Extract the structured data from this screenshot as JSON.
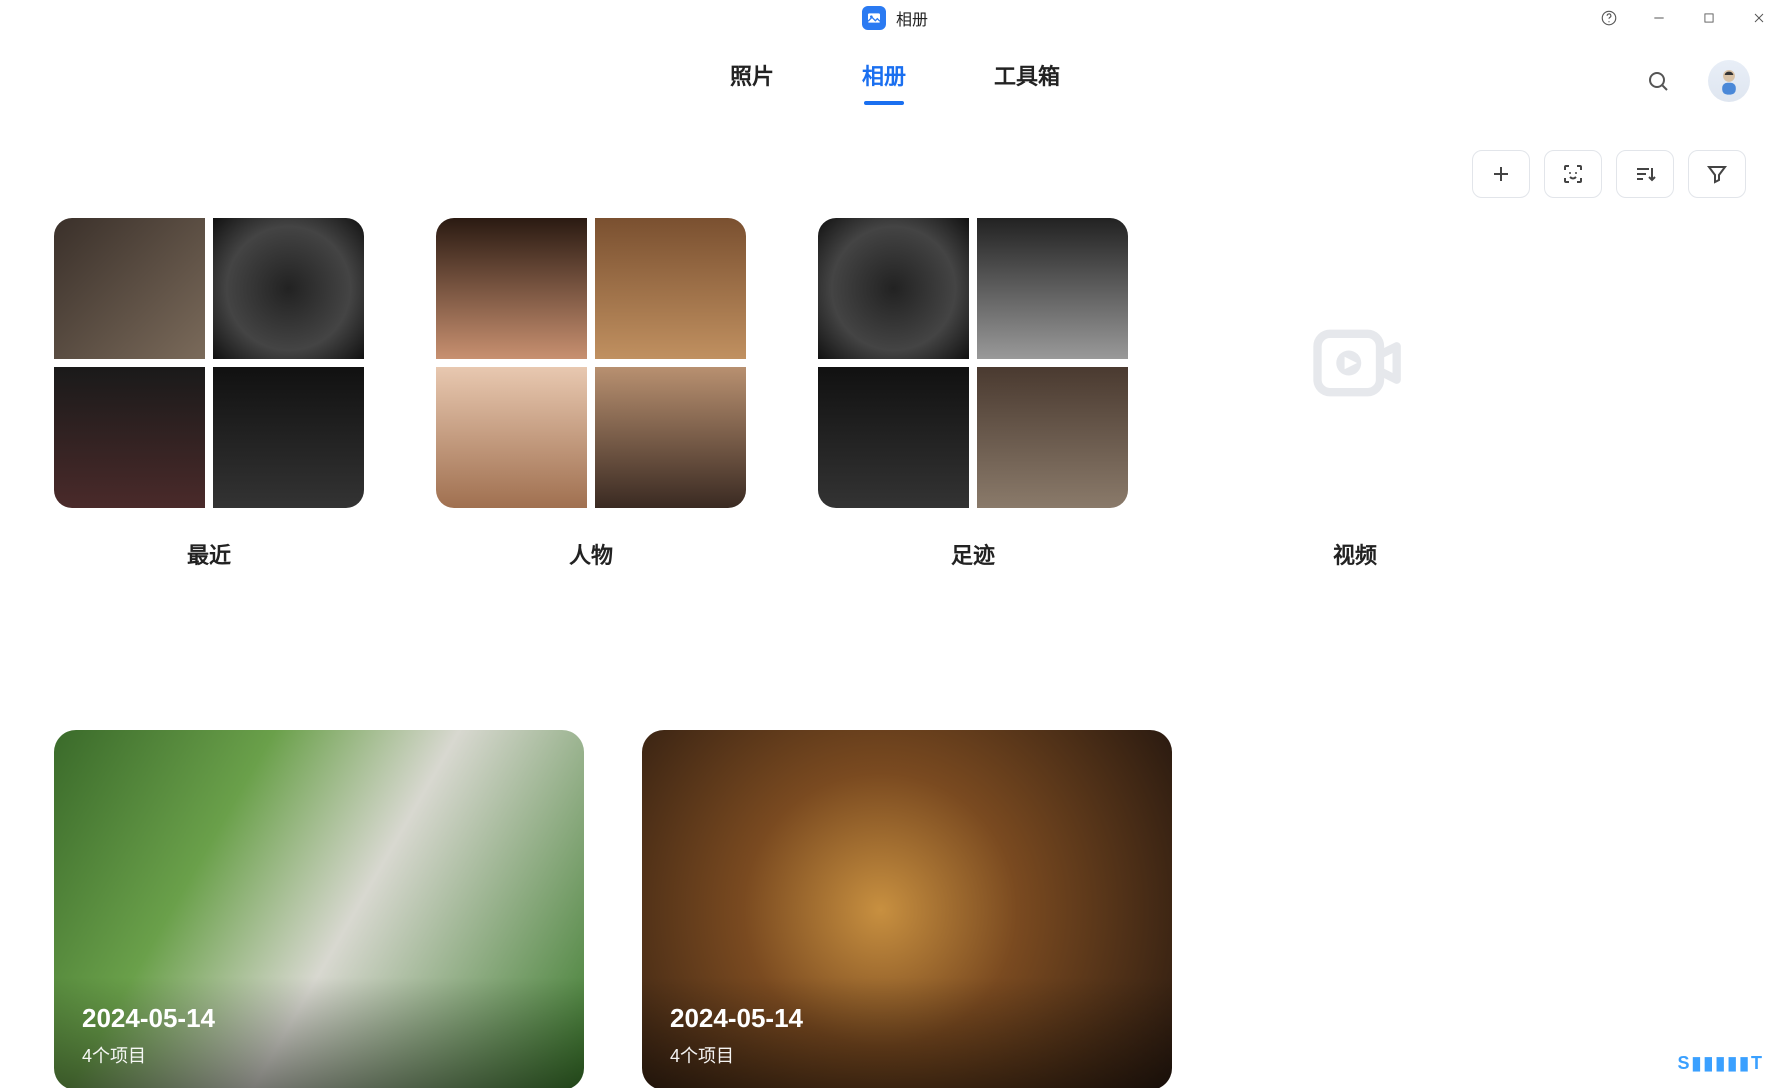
{
  "app": {
    "title": "相册"
  },
  "tabs": {
    "photos": "照片",
    "albums": "相册",
    "toolbox": "工具箱",
    "active": "albums"
  },
  "tooltips": {
    "help": "帮助",
    "minimize": "最小化",
    "maximize": "最大化",
    "close": "关闭",
    "search": "搜索",
    "avatar": "个人头像",
    "add": "新建相册",
    "face": "人脸识别",
    "sort": "排序",
    "filter": "筛选"
  },
  "categories": {
    "recent": "最近",
    "people": "人物",
    "footprints": "足迹",
    "video": "视频"
  },
  "user_albums": [
    {
      "title": "2024-05-14",
      "subtitle": "4个项目",
      "key": "dog"
    },
    {
      "title": "2024-05-14",
      "subtitle": "4个项目",
      "key": "cat"
    }
  ],
  "watermark": "S▮▮▮▮▮T"
}
